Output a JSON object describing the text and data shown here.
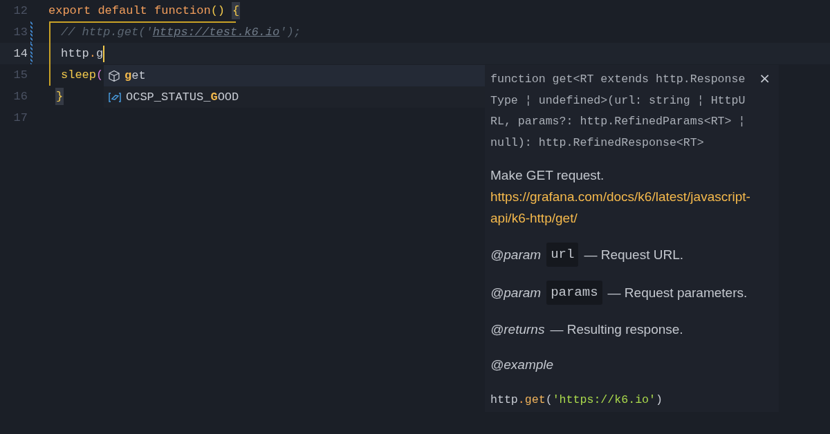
{
  "editor": {
    "lines": [
      {
        "number": "12",
        "current": false,
        "tokens": [
          {
            "kind": "keyword",
            "text": "export default function"
          },
          {
            "kind": "paren",
            "text": "()"
          },
          {
            "kind": "bracket-match",
            "text": "{"
          }
        ],
        "children": [
          {
            "number": "13",
            "current": false,
            "modified": true,
            "tokens": [
              {
                "kind": "comment",
                "text": "// http.get('"
              },
              {
                "kind": "comment-link",
                "text": "https://test.k6.io"
              },
              {
                "kind": "comment",
                "text": "');"
              }
            ]
          },
          {
            "number": "14",
            "current": true,
            "modified": true,
            "tokens": [
              {
                "kind": "ident",
                "text": "http"
              },
              {
                "kind": "operator",
                "text": "."
              },
              {
                "kind": "ident",
                "text": "g"
              },
              {
                "kind": "cursor"
              }
            ]
          },
          {
            "number": "15",
            "current": false,
            "tokens": [
              {
                "kind": "function",
                "text": "sleep"
              },
              {
                "kind": "call-paren",
                "text": "("
              }
            ]
          }
        ]
      },
      {
        "number": "16",
        "current": false,
        "tokens": [
          {
            "kind": "bracket-match",
            "text": "}"
          }
        ]
      },
      {
        "number": "17",
        "current": false
      }
    ]
  },
  "suggestions": [
    {
      "kind": "method",
      "selected": true,
      "label": "**g**et"
    },
    {
      "kind": "constant",
      "selected": false,
      "label": "OCSP_STATUS_**G**OOD"
    }
  ],
  "hover": {
    "close": "×",
    "signature_lines": [
      "function get<RT extends http.Response",
      "Type ¦ undefined>(url: string ¦ HttpU",
      "RL, params?: http.RefinedParams<RT> ¦",
      "null): http.RefinedResponse<RT>"
    ],
    "description": "Make GET request.",
    "link_lines": [
      "https://grafana.com/docs/k6/latest/javascript-",
      "api/k6-http/get/"
    ],
    "tags": [
      {
        "kind": "param",
        "tag": "@param",
        "name": "url",
        "text": "— Request URL."
      },
      {
        "kind": "param",
        "tag": "@param",
        "name": "params",
        "text": "— Request parameters."
      },
      {
        "kind": "returns",
        "tag": "@returns",
        "text": "— Resulting response."
      },
      {
        "kind": "example",
        "tag": "@example",
        "code": [
          {
            "kind": "ident",
            "text": "http"
          },
          {
            "kind": "operator",
            "text": "."
          },
          {
            "kind": "method",
            "text": "get"
          },
          {
            "kind": "ident",
            "text": "("
          },
          {
            "kind": "string",
            "text": "'https://k6.io'"
          },
          {
            "kind": "ident",
            "text": ")"
          }
        ]
      }
    ]
  }
}
